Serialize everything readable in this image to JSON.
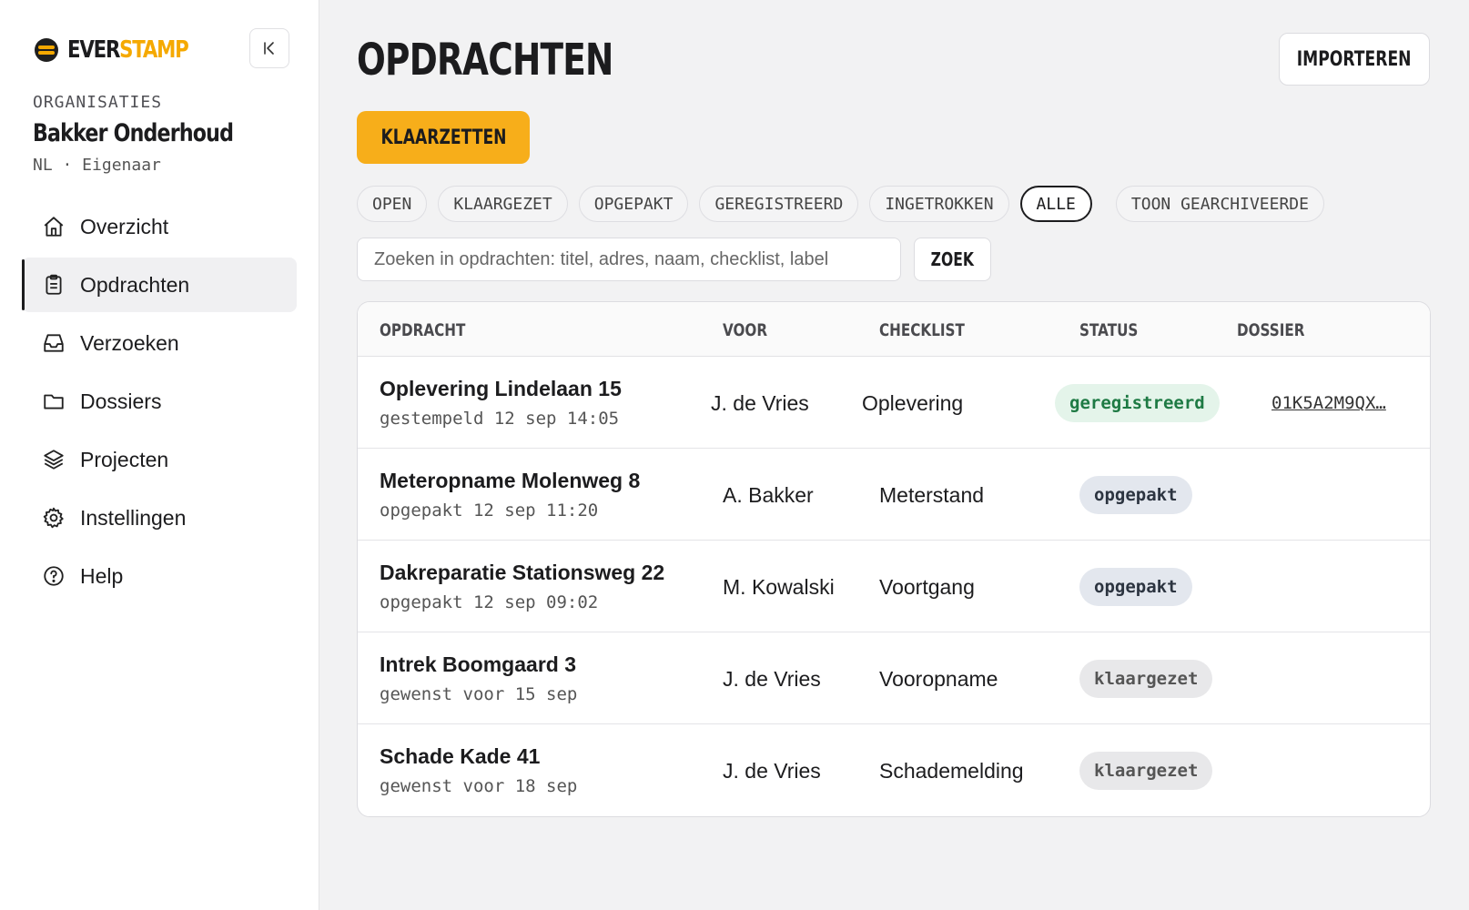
{
  "brand": {
    "part1": "EVER",
    "part2": "STAMP"
  },
  "org": {
    "label": "ORGANISATIES",
    "name": "Bakker Onderhoud",
    "meta": "NL · Eigenaar"
  },
  "nav": [
    {
      "label": "Overzicht",
      "icon": "home-icon"
    },
    {
      "label": "Opdrachten",
      "icon": "clipboard-icon",
      "active": true
    },
    {
      "label": "Verzoeken",
      "icon": "inbox-icon"
    },
    {
      "label": "Dossiers",
      "icon": "folder-icon"
    },
    {
      "label": "Projecten",
      "icon": "layers-icon"
    },
    {
      "label": "Instellingen",
      "icon": "gear-icon"
    },
    {
      "label": "Help",
      "icon": "help-icon"
    }
  ],
  "header": {
    "title": "OPDRACHTEN",
    "import_label": "IMPORTEREN",
    "primary_label": "KLAARZETTEN"
  },
  "filters": [
    "OPEN",
    "KLAARGEZET",
    "OPGEPAKT",
    "GEREGISTREERD",
    "INGETROKKEN",
    "ALLE"
  ],
  "active_filter": "ALLE",
  "archive_toggle": "TOON GEARCHIVEERDE",
  "search": {
    "placeholder": "Zoeken in opdrachten: titel, adres, naam, checklist, label",
    "button": "ZOEK"
  },
  "table": {
    "columns": [
      "OPDRACHT",
      "VOOR",
      "CHECKLIST",
      "STATUS",
      "DOSSIER"
    ],
    "rows": [
      {
        "title": "Oplevering Lindelaan 15",
        "sub": "gestempeld 12 sep 14:05",
        "voor": "J. de Vries",
        "checklist": "Oplevering",
        "status": "geregistreerd",
        "dossier": "01K5A2M9QX…"
      },
      {
        "title": "Meteropname Molenweg 8",
        "sub": "opgepakt 12 sep 11:20",
        "voor": "A. Bakker",
        "checklist": "Meterstand",
        "status": "opgepakt",
        "dossier": ""
      },
      {
        "title": "Dakreparatie Stationsweg 22",
        "sub": "opgepakt 12 sep 09:02",
        "voor": "M. Kowalski",
        "checklist": "Voortgang",
        "status": "opgepakt",
        "dossier": ""
      },
      {
        "title": "Intrek Boomgaard 3",
        "sub": "gewenst voor 15 sep",
        "voor": "J. de Vries",
        "checklist": "Vooropname",
        "status": "klaargezet",
        "dossier": ""
      },
      {
        "title": "Schade Kade 41",
        "sub": "gewenst voor 18 sep",
        "voor": "J. de Vries",
        "checklist": "Schademelding",
        "status": "klaargezet",
        "dossier": ""
      }
    ]
  },
  "colors": {
    "accent": "#f7ae1a",
    "brand_accent": "#f5a900",
    "registered": "#1e7a44"
  }
}
